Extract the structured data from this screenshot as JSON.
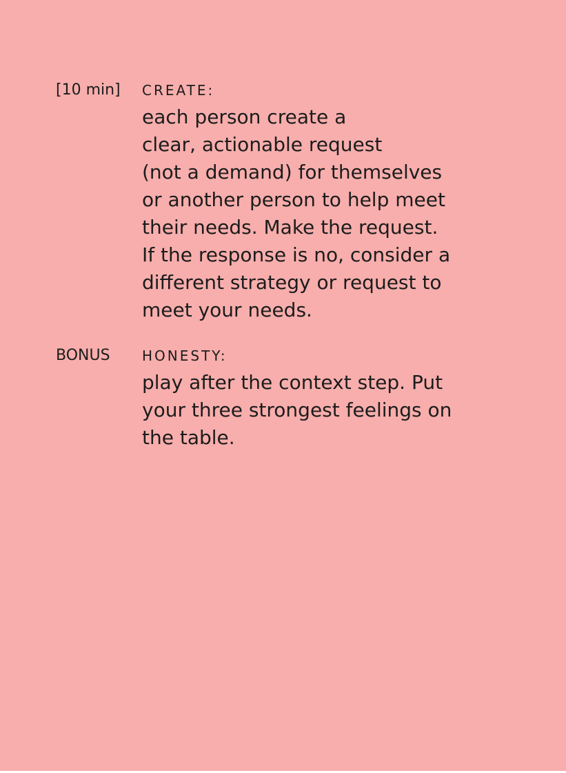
{
  "sections": [
    {
      "label": "[10 min]",
      "heading": "CREATE:",
      "lines": [
        "each person create a",
        "clear, actionable request",
        "(not a demand) for themselves",
        "or another person to help meet",
        "their needs. Make the request.",
        "If the response is no, consider a",
        "different strategy or request to",
        "meet your needs."
      ]
    },
    {
      "label": "BONUS",
      "heading": "HONESTY:",
      "lines": [
        "play after the context step. Put",
        "your three strongest feelings on",
        "the table."
      ]
    }
  ],
  "colors": {
    "background": "#f7aeac",
    "text": "#1c1c1c"
  }
}
